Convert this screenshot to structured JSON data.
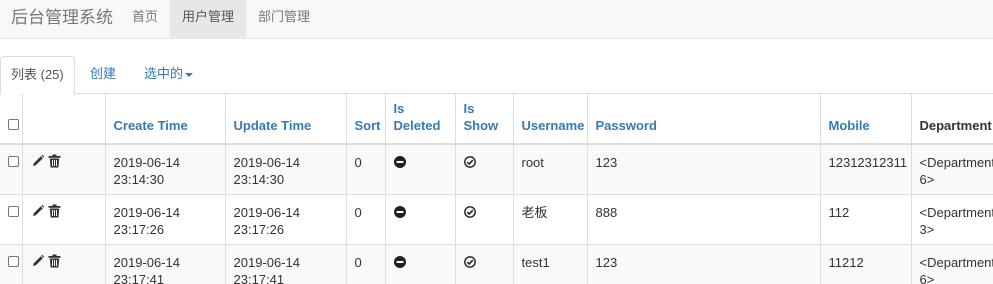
{
  "navbar": {
    "brand": "后台管理系统",
    "items": [
      {
        "label": "首页",
        "active": false
      },
      {
        "label": "用户管理",
        "active": true
      },
      {
        "label": "部门管理",
        "active": false
      }
    ]
  },
  "tabs": {
    "list": "列表 (25)",
    "create": "创建",
    "selected": "选中的"
  },
  "table": {
    "headers": [
      "",
      "",
      "Create Time",
      "Update Time",
      "Sort",
      "Is Deleted",
      "Is Show",
      "Username",
      "Password",
      "Mobile",
      "Department"
    ],
    "rows": [
      {
        "create_date": "2019-06-14",
        "create_time": "23:14:30",
        "update_date": "2019-06-14",
        "update_time": "23:14:30",
        "sort": "0",
        "username": "root",
        "password": "123",
        "mobile": "12312312311",
        "dept_a": "<Department",
        "dept_b": "6>"
      },
      {
        "create_date": "2019-06-14",
        "create_time": "23:17:26",
        "update_date": "2019-06-14",
        "update_time": "23:17:26",
        "sort": "0",
        "username": "老板",
        "password": "888",
        "mobile": "112",
        "dept_a": "<Department",
        "dept_b": "3>"
      },
      {
        "create_date": "2019-06-14",
        "create_time": "23:17:41",
        "update_date": "2019-06-14",
        "update_time": "23:17:41",
        "sort": "0",
        "username": "test1",
        "password": "123",
        "mobile": "11212",
        "dept_a": "<Department",
        "dept_b": "6>"
      }
    ]
  },
  "icons": {
    "edit": "pencil-icon",
    "delete": "trash-icon",
    "is_deleted": "minus-circle-icon",
    "is_show": "ok-circle-icon"
  },
  "colors": {
    "link": "#337ab7",
    "navbar_bg": "#f8f8f8",
    "active_nav_bg": "#e7e7e7",
    "stripe": "#f9f9f9",
    "border": "#dddddd"
  }
}
